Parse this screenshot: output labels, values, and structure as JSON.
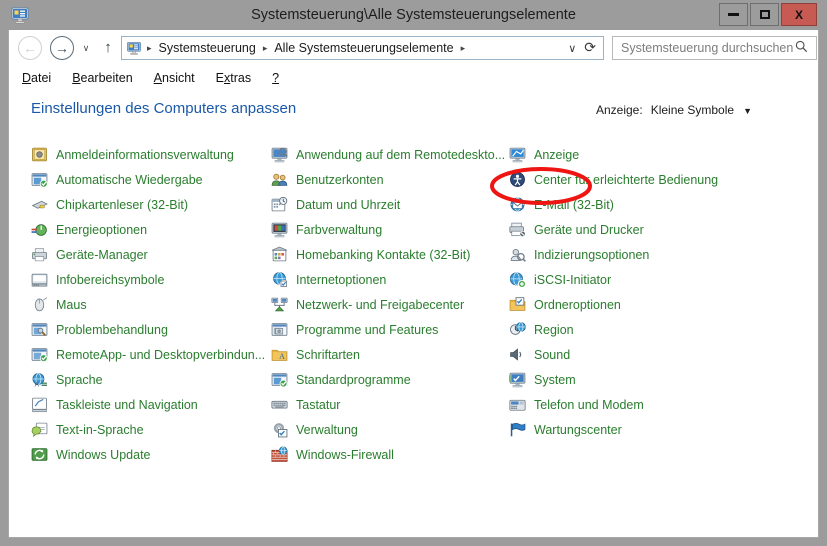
{
  "window": {
    "title": "Systemsteuerung\\Alle Systemsteuerungselemente",
    "icon": "control-panel-icon",
    "controls": {
      "minimize": "–",
      "maximize": "□",
      "close": "X"
    }
  },
  "nav": {
    "back_tooltip": "Zurück",
    "forward_tooltip": "Vorwärts",
    "recent_caret": "∨",
    "up_arrow": "↑",
    "breadcrumbs": [
      "Systemsteuerung",
      "Alle Systemsteuerungselemente"
    ],
    "separator": "▸",
    "dropdown_caret": "∨",
    "refresh": "⟳"
  },
  "search": {
    "placeholder": "Systemsteuerung durchsuchen",
    "icon": "search-icon"
  },
  "menubar": {
    "items": [
      {
        "pre": "",
        "key": "D",
        "post": "atei"
      },
      {
        "pre": "",
        "key": "B",
        "post": "earbeiten"
      },
      {
        "pre": "",
        "key": "A",
        "post": "nsicht"
      },
      {
        "pre": "E",
        "key": "x",
        "post": "tras"
      },
      {
        "pre": "",
        "key": "?",
        "post": ""
      }
    ]
  },
  "header": {
    "page_title": "Einstellungen des Computers anpassen",
    "view_label": "Anzeige:",
    "view_value": "Kleine Symbole",
    "view_caret": "▼"
  },
  "colors": {
    "item_text": "#2a7d2e",
    "page_title": "#1a59a8",
    "annotation": "#ee1512",
    "titlebar": "#9c9c9c",
    "close_button": "#c75a52"
  },
  "columns": [
    {
      "items": [
        {
          "label": "Anmeldeinformationsverwaltung",
          "icon": "credentials-icon"
        },
        {
          "label": "Automatische Wiedergabe",
          "icon": "autoplay-icon"
        },
        {
          "label": "Chipkartenleser (32-Bit)",
          "icon": "smartcard-reader-icon"
        },
        {
          "label": "Energieoptionen",
          "icon": "power-options-icon"
        },
        {
          "label": "Geräte-Manager",
          "icon": "device-manager-icon"
        },
        {
          "label": "Infobereichsymbole",
          "icon": "notification-area-icon"
        },
        {
          "label": "Maus",
          "icon": "mouse-icon"
        },
        {
          "label": "Problembehandlung",
          "icon": "troubleshooting-icon"
        },
        {
          "label": "RemoteApp- und Desktopverbindun...",
          "icon": "remoteapp-icon"
        },
        {
          "label": "Sprache",
          "icon": "language-icon"
        },
        {
          "label": "Taskleiste und Navigation",
          "icon": "taskbar-icon"
        },
        {
          "label": "Text-in-Sprache",
          "icon": "text-to-speech-icon"
        },
        {
          "label": "Windows Update",
          "icon": "windows-update-icon"
        }
      ]
    },
    {
      "items": [
        {
          "label": "Anwendung auf dem Remotedeskto...",
          "icon": "remote-desktop-app-icon"
        },
        {
          "label": "Benutzerkonten",
          "icon": "user-accounts-icon"
        },
        {
          "label": "Datum und Uhrzeit",
          "icon": "date-time-icon"
        },
        {
          "label": "Farbverwaltung",
          "icon": "color-management-icon"
        },
        {
          "label": "Homebanking Kontakte (32-Bit)",
          "icon": "homebanking-icon"
        },
        {
          "label": "Internetoptionen",
          "icon": "internet-options-icon"
        },
        {
          "label": "Netzwerk- und Freigabecenter",
          "icon": "network-sharing-icon"
        },
        {
          "label": "Programme und Features",
          "icon": "programs-features-icon"
        },
        {
          "label": "Schriftarten",
          "icon": "fonts-icon"
        },
        {
          "label": "Standardprogramme",
          "icon": "default-programs-icon"
        },
        {
          "label": "Tastatur",
          "icon": "keyboard-icon"
        },
        {
          "label": "Verwaltung",
          "icon": "administrative-tools-icon"
        },
        {
          "label": "Windows-Firewall",
          "icon": "firewall-icon"
        }
      ]
    },
    {
      "items": [
        {
          "label": "Anzeige",
          "icon": "display-icon",
          "annotated": true
        },
        {
          "label": "Center für erleichterte Bedienung",
          "icon": "ease-of-access-icon"
        },
        {
          "label": "E-Mail (32-Bit)",
          "icon": "mail-icon"
        },
        {
          "label": "Geräte und Drucker",
          "icon": "devices-printers-icon"
        },
        {
          "label": "Indizierungsoptionen",
          "icon": "indexing-options-icon"
        },
        {
          "label": "iSCSI-Initiator",
          "icon": "iscsi-initiator-icon"
        },
        {
          "label": "Ordneroptionen",
          "icon": "folder-options-icon"
        },
        {
          "label": "Region",
          "icon": "region-icon"
        },
        {
          "label": "Sound",
          "icon": "sound-icon"
        },
        {
          "label": "System",
          "icon": "system-icon"
        },
        {
          "label": "Telefon und Modem",
          "icon": "phone-modem-icon"
        },
        {
          "label": "Wartungscenter",
          "icon": "action-center-icon"
        }
      ]
    }
  ]
}
